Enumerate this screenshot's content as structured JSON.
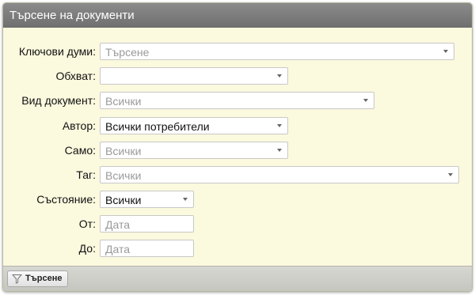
{
  "panel": {
    "title": "Търсене на документи"
  },
  "form": {
    "keywords": {
      "label": "Ключови думи:",
      "placeholder": "Търсене"
    },
    "scope": {
      "label": "Обхват:",
      "value": ""
    },
    "doc_type": {
      "label": "Вид документ:",
      "value": "Всички"
    },
    "author": {
      "label": "Автор:",
      "value": "Всички потребители"
    },
    "only": {
      "label": "Само:",
      "value": "Всички"
    },
    "tag": {
      "label": "Таг:",
      "value": "Всички"
    },
    "status": {
      "label": "Състояние:",
      "value": "Всички"
    },
    "from": {
      "label": "От:",
      "placeholder": "Дата"
    },
    "to": {
      "label": "До:",
      "placeholder": "Дата"
    }
  },
  "footer": {
    "search_label": "Търсене"
  },
  "icons": {
    "search_button_icon": "funnel-icon",
    "dropdown_icon": "chevron-down-icon"
  }
}
